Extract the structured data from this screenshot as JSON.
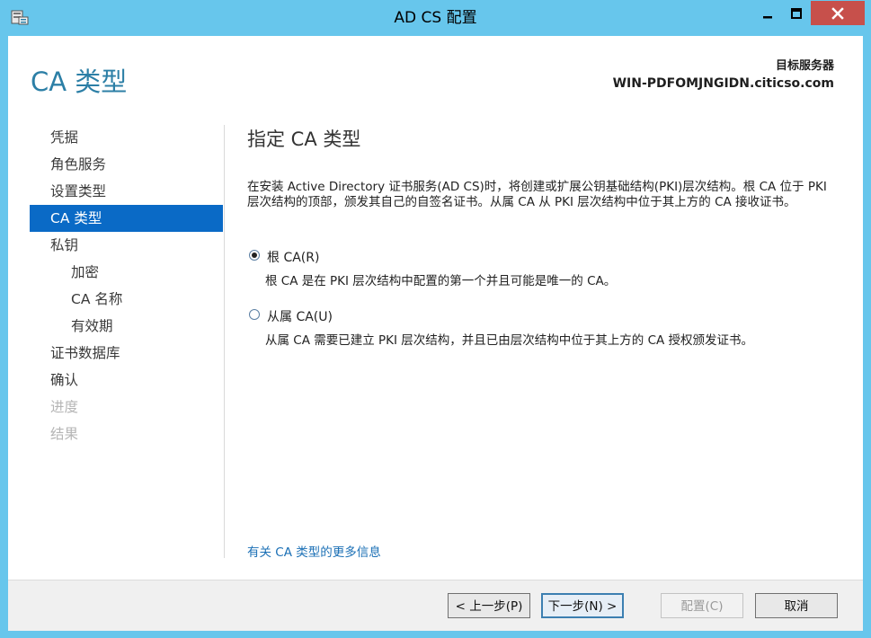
{
  "window": {
    "title": "AD CS 配置"
  },
  "header": {
    "page_title": "CA 类型",
    "server_label": "目标服务器",
    "server_name": "WIN-PDFOMJNGIDN.citicso.com"
  },
  "nav": {
    "items": [
      {
        "label": "凭据",
        "state": "normal"
      },
      {
        "label": "角色服务",
        "state": "normal"
      },
      {
        "label": "设置类型",
        "state": "normal"
      },
      {
        "label": "CA 类型",
        "state": "active"
      },
      {
        "label": "私钥",
        "state": "normal"
      },
      {
        "label": "加密",
        "state": "sub"
      },
      {
        "label": "CA 名称",
        "state": "sub"
      },
      {
        "label": "有效期",
        "state": "sub"
      },
      {
        "label": "证书数据库",
        "state": "normal"
      },
      {
        "label": "确认",
        "state": "normal"
      },
      {
        "label": "进度",
        "state": "disabled"
      },
      {
        "label": "结果",
        "state": "disabled"
      }
    ]
  },
  "main": {
    "section_title": "指定 CA 类型",
    "description": "在安装 Active Directory 证书服务(AD CS)时，将创建或扩展公钥基础结构(PKI)层次结构。根 CA 位于 PKI 层次结构的顶部，颁发其自己的自签名证书。从属 CA 从 PKI 层次结构中位于其上方的 CA 接收证书。",
    "options": [
      {
        "label": "根 CA(R)",
        "description": "根 CA 是在 PKI 层次结构中配置的第一个并且可能是唯一的 CA。",
        "selected": true
      },
      {
        "label": "从属 CA(U)",
        "description": "从属 CA 需要已建立 PKI 层次结构，并且已由层次结构中位于其上方的 CA 授权颁发证书。",
        "selected": false
      }
    ],
    "more_info_link": "有关 CA 类型的更多信息"
  },
  "footer": {
    "prev_label": "< 上一步(P)",
    "next_label": "下一步(N) >",
    "configure_label": "配置(C)",
    "cancel_label": "取消"
  },
  "colors": {
    "frame": "#67c6ec",
    "accent": "#0a6ac6",
    "title_text": "#2c7fa6",
    "link": "#1a6fb5",
    "close_button": "#c7504b"
  }
}
